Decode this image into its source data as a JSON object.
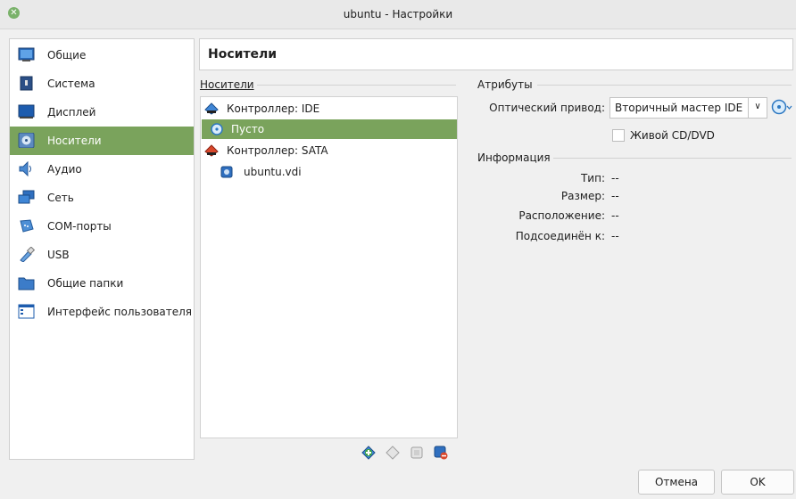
{
  "window": {
    "title": "ubuntu - Настройки"
  },
  "sidebar": {
    "items": [
      {
        "label": "Общие",
        "icon": "general-icon"
      },
      {
        "label": "Система",
        "icon": "system-icon"
      },
      {
        "label": "Дисплей",
        "icon": "display-icon"
      },
      {
        "label": "Носители",
        "icon": "storage-icon",
        "active": true
      },
      {
        "label": "Аудио",
        "icon": "audio-icon"
      },
      {
        "label": "Сеть",
        "icon": "network-icon"
      },
      {
        "label": "COM-порты",
        "icon": "serial-ports-icon"
      },
      {
        "label": "USB",
        "icon": "usb-icon"
      },
      {
        "label": "Общие папки",
        "icon": "shared-folders-icon"
      },
      {
        "label": "Интерфейс пользователя",
        "icon": "user-interface-icon"
      }
    ]
  },
  "page": {
    "heading": "Носители"
  },
  "storage": {
    "section_label": "Носители",
    "tree": [
      {
        "label": "Контроллер: IDE",
        "type": "controller",
        "icon": "ide-controller-icon"
      },
      {
        "label": "Пусто",
        "type": "optical",
        "icon": "optical-disc-icon",
        "selected": true
      },
      {
        "label": "Контроллер: SATA",
        "type": "controller",
        "icon": "sata-controller-icon"
      },
      {
        "label": "ubuntu.vdi",
        "type": "hdd",
        "icon": "hard-disk-icon"
      }
    ],
    "toolbar": [
      "add-attachment-icon",
      "remove-attachment-icon",
      "controller-settings-icon",
      "remove-controller-icon"
    ]
  },
  "attributes": {
    "section_label": "Атрибуты",
    "drive_label": "Оптический привод:",
    "drive_value": "Вторичный мастер IDE",
    "live_cd_label": "Живой CD/DVD",
    "live_cd_checked": false
  },
  "info": {
    "section_label": "Информация",
    "rows": [
      {
        "label": "Тип:",
        "value": "--"
      },
      {
        "label": "Размер:",
        "value": "--"
      },
      {
        "label": "Расположение:",
        "value": "--"
      },
      {
        "label": "Подсоединён к:",
        "value": "--"
      }
    ]
  },
  "buttons": {
    "cancel": "Отмена",
    "ok": "OK"
  },
  "colors": {
    "accent": "#7aa35c"
  }
}
